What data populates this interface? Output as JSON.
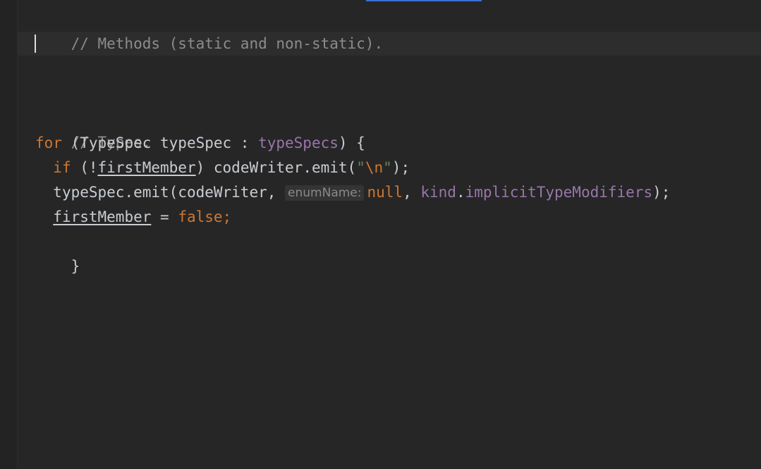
{
  "editor": {
    "lines": {
      "l1": {
        "comment": "// Methods (static and non-static)."
      },
      "l2": {
        "comment": "// Types."
      },
      "l3": {
        "kw_for": "for",
        "p1": " (TypeSpec typeSpec : ",
        "field": "typeSpecs",
        "p2": ") {"
      },
      "l4": {
        "indent": "  ",
        "kw_if": "if",
        "p1": " (!",
        "var": "firstMember",
        "p2": ") codeWriter.emit(",
        "str_open": "\"",
        "esc": "\\n",
        "str_close": "\"",
        "p3": ");"
      },
      "l5": {
        "indent": "  ",
        "p1": "typeSpec.emit(codeWriter, ",
        "hint": "enumName:",
        "kw_null": "null",
        "p2": ", ",
        "field1": "kind",
        "p3": ".",
        "field2": "implicitTypeModifiers",
        "p4": ");"
      },
      "l6": {
        "indent": "  ",
        "var": "firstMember",
        "p1": " = ",
        "kw_false": "false",
        "p2": ";"
      },
      "l7": {
        "brace": "}"
      }
    }
  }
}
